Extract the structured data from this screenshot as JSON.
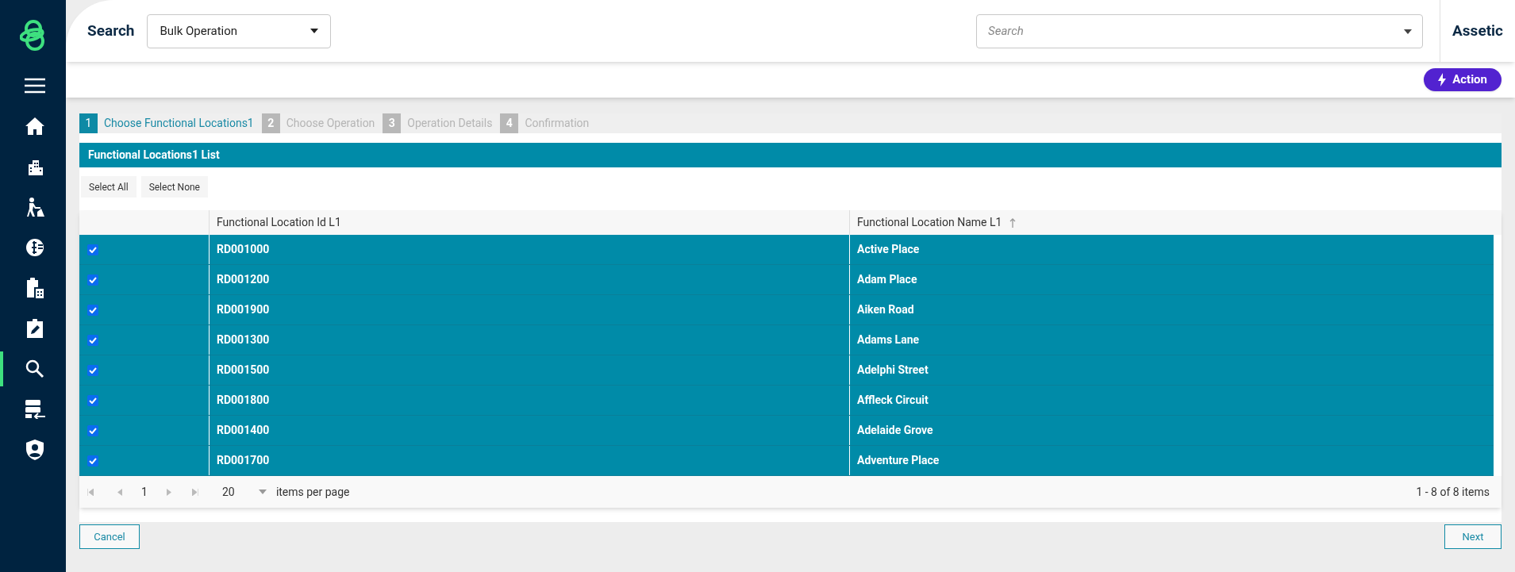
{
  "sidebar": {
    "items": [
      {
        "kind": "menu",
        "selected": false
      },
      {
        "kind": "home",
        "selected": false
      },
      {
        "kind": "building",
        "selected": false
      },
      {
        "kind": "worker",
        "selected": false
      },
      {
        "kind": "finance",
        "selected": false
      },
      {
        "kind": "calculator",
        "selected": false
      },
      {
        "kind": "edit",
        "selected": false
      },
      {
        "kind": "search",
        "selected": true
      },
      {
        "kind": "import",
        "selected": false
      },
      {
        "kind": "shield",
        "selected": false
      }
    ]
  },
  "header": {
    "title": "Search",
    "type_select": {
      "value": "Bulk Operation"
    },
    "search": {
      "placeholder": "Search"
    },
    "brand": "Assetic"
  },
  "action_button": "Action",
  "steps": [
    {
      "number": "1",
      "label": "Choose Functional Locations1",
      "selected": true
    },
    {
      "number": "2",
      "label": "Choose Operation",
      "selected": false
    },
    {
      "number": "3",
      "label": "Operation Details",
      "selected": false
    },
    {
      "number": "4",
      "label": "Confirmation",
      "selected": false
    }
  ],
  "list": {
    "title": "Functional Locations1 List",
    "buttons": [
      "Select All",
      "Select None"
    ],
    "columns": [
      "Functional Location Id L1",
      "Functional Location Name L1"
    ],
    "rows": [
      {
        "checked": true,
        "id": "RD001000",
        "name": "Active Place"
      },
      {
        "checked": true,
        "id": "RD001200",
        "name": "Adam Place"
      },
      {
        "checked": true,
        "id": "RD001900",
        "name": "Aiken Road"
      },
      {
        "checked": true,
        "id": "RD001300",
        "name": "Adams Lane"
      },
      {
        "checked": true,
        "id": "RD001500",
        "name": "Adelphi Street"
      },
      {
        "checked": true,
        "id": "RD001800",
        "name": "Affleck Circuit"
      },
      {
        "checked": true,
        "id": "RD001400",
        "name": "Adelaide Grove"
      },
      {
        "checked": true,
        "id": "RD001700",
        "name": "Adventure Place"
      }
    ],
    "pager": {
      "page": "1",
      "page_size": "20",
      "page_size_label": "items per page",
      "summary": "1 - 8 of 8 items"
    }
  },
  "footer": {
    "cancel": "Cancel",
    "next": "Next"
  }
}
